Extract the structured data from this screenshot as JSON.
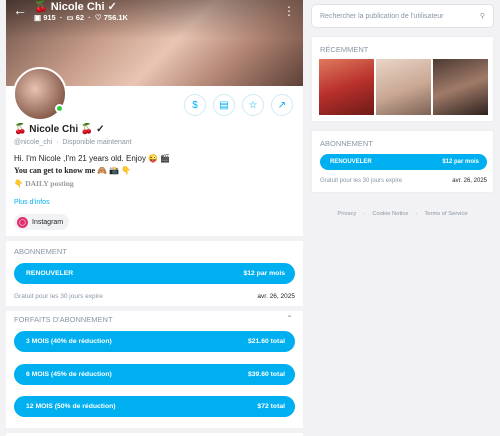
{
  "header": {
    "name": "Nicole Chi",
    "name_emoji": "🍒",
    "images": "915",
    "videos": "62",
    "likes": "756.1K"
  },
  "profile": {
    "name": "Nicole Chi",
    "handle": "@nicole_chi",
    "status": "Disponible maintenant",
    "bio_line1": "Hi. I'm Nicole ,I'm 21 years old. Enjoy 😜 🎬",
    "bio_line2": "You can get to know me 🙈 📸 👇",
    "bio_line3": "👇 DAILY posting",
    "more_info": "Plus d'infos",
    "instagram": "Instagram"
  },
  "subscription": {
    "title": "ABONNEMENT",
    "button_label": "RENOUVELER",
    "button_price": "$12 par mois",
    "note": "Gratuit pour les 30 jours expire",
    "date": "avr. 26, 2025"
  },
  "bundles": {
    "title": "FORFAITS D'ABONNEMENT",
    "items": [
      {
        "label": "3 MOIS (40% de réduction)",
        "price": "$21.60 total"
      },
      {
        "label": "6 MOIS (45% de réduction)",
        "price": "$39.60 total"
      },
      {
        "label": "12 MOIS (50% de réduction)",
        "price": "$72 total"
      }
    ]
  },
  "sidebar": {
    "search_placeholder": "Rechercher la publication de l'utilisateur",
    "recent_title": "RÉCEMMENT",
    "sub_title": "ABONNEMENT",
    "sub_button_label": "RENOUVELER",
    "sub_button_price": "$12 par mois",
    "sub_note": "Gratuit pour les 30 jours expire",
    "sub_date": "avr. 26, 2025",
    "footer": [
      "Privacy",
      "Cookie Notice",
      "Terms of Service"
    ]
  },
  "colors": {
    "accent": "#00aff0",
    "online": "#2ecc40",
    "muted": "#8a96a3"
  },
  "icons": [
    "back-arrow-icon",
    "image-icon",
    "video-icon",
    "heart-icon",
    "kebab-icon",
    "dollar-icon",
    "message-icon",
    "star-icon",
    "share-icon",
    "instagram-icon",
    "chevron-up-icon",
    "search-icon"
  ]
}
